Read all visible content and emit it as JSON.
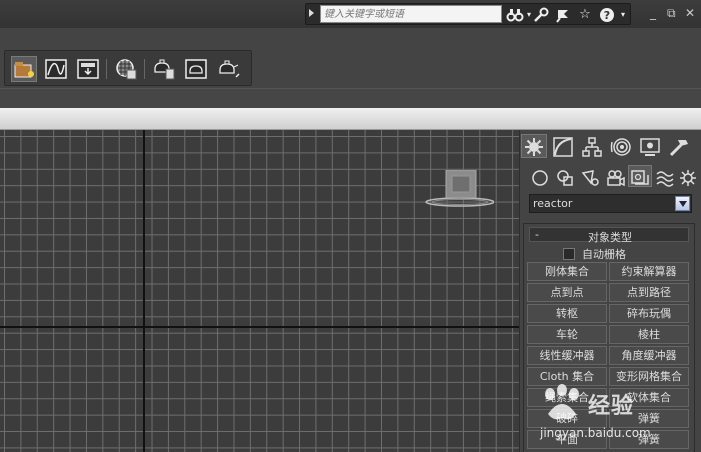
{
  "search": {
    "placeholder": "键入关键字或短语"
  },
  "icons": {
    "title_bar": [
      "binoculars-icon",
      "search-tools-icon",
      "pin-icon",
      "star-icon",
      "help-icon"
    ],
    "window_controls": [
      "minimize-icon",
      "restore-icon",
      "close-icon"
    ],
    "toolbar": [
      "scene-explorer-icon",
      "curve-editor-icon",
      "schematic-view-icon",
      "material-editor-icon",
      "render-setup-icon",
      "rendered-frame-icon",
      "render-icon"
    ],
    "command_tabs": [
      "create-tab-icon",
      "modify-tab-icon",
      "hierarchy-tab-icon",
      "motion-tab-icon",
      "display-tab-icon",
      "utilities-tab-icon"
    ],
    "categories": [
      "geometry-icon",
      "shapes-icon",
      "lights-icon",
      "cameras-icon",
      "helpers-icon",
      "space-warps-icon",
      "systems-icon"
    ]
  },
  "window_controls": {
    "minimize": "_",
    "restore": "⧉",
    "close": "✕"
  },
  "command_panel": {
    "dropdown_value": "reactor",
    "rollout": {
      "title": "对象类型",
      "collapse": "-",
      "auto_grid": "自动栅格",
      "buttons": [
        [
          "刚体集合",
          "约束解算器"
        ],
        [
          "点到点",
          "点到路径"
        ],
        [
          "转枢",
          "碎布玩偶"
        ],
        [
          "车轮",
          "棱柱"
        ],
        [
          "线性缓冲器",
          "角度缓冲器"
        ],
        [
          "Cloth 集合",
          "变形网格集合"
        ],
        [
          "绳索集合",
          "软体集合"
        ],
        [
          "破碎",
          "弹簧"
        ],
        [
          "平面",
          "弹簧"
        ]
      ]
    }
  },
  "watermark": {
    "text": "经验",
    "url": "jingyan.baidu.com"
  },
  "colors": {
    "background": "#444444",
    "viewport_bg": "#3c3c3c",
    "grid_line": "#6e6e6e",
    "axis_line": "#111111",
    "dropdown_arrow_bg": "#c8d4f0"
  }
}
